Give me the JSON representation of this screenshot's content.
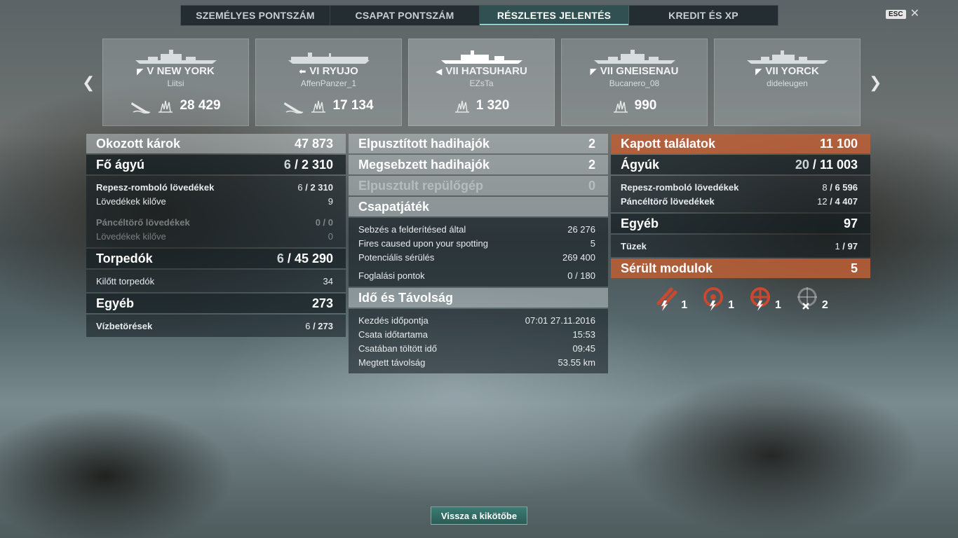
{
  "tabs": [
    "SZEMÉLYES PONTSZÁM",
    "CSAPAT PONTSZÁM",
    "RÉSZLETES JELENTÉS",
    "KREDIT ÉS XP"
  ],
  "esc_label": "ESC",
  "cards": [
    {
      "tier": "V",
      "name": "NEW YORK",
      "player": "Liitsi",
      "damage": "28 429",
      "class_icon": "battleship-icon",
      "has_kill": true
    },
    {
      "tier": "VI",
      "name": "RYUJO",
      "player": "AffenPanzer_1",
      "damage": "17 134",
      "class_icon": "carrier-icon",
      "has_kill": true
    },
    {
      "tier": "VII",
      "name": "HATSUHARU",
      "player": "EZsTa",
      "damage": "1 320",
      "class_icon": "destroyer-icon",
      "has_kill": false
    },
    {
      "tier": "VII",
      "name": "GNEISENAU",
      "player": "Bucanero_08",
      "damage": "990",
      "class_icon": "battleship-icon",
      "has_kill": false
    },
    {
      "tier": "VII",
      "name": "YORCK",
      "player": "dideleugen",
      "damage": "",
      "class_icon": "cruiser-icon",
      "has_kill": false
    }
  ],
  "left": {
    "damage": {
      "label": "Okozott károk",
      "value": "47 873"
    },
    "main_guns": {
      "label": "Fő ágyú",
      "hits": "6",
      "value": "2 310"
    },
    "he": {
      "label": "Repesz-romboló lövedékek",
      "hits": "6",
      "value": "2 310"
    },
    "he_fired": {
      "label": "Lövedékek kilőve",
      "value": "9"
    },
    "ap": {
      "label": "Páncéltörő lövedékek",
      "value": "0 / 0"
    },
    "ap_fired": {
      "label": "Lövedékek kilőve",
      "value": "0"
    },
    "torpedoes": {
      "label": "Torpedók",
      "hits": "6",
      "value": "45 290"
    },
    "torp_fired": {
      "label": "Kilőtt torpedók",
      "value": "34"
    },
    "other": {
      "label": "Egyéb",
      "value": "273"
    },
    "flooding": {
      "label": "Vízbetörések",
      "hits": "6",
      "value": "273"
    }
  },
  "middle": {
    "destroyed": {
      "label": "Elpusztított hadihajók",
      "value": "2"
    },
    "damaged": {
      "label": "Megsebzett hadihajók",
      "value": "2"
    },
    "planes": {
      "label": "Elpusztult repülőgép",
      "value": "0"
    },
    "team_head": "Csapatjáték",
    "spotting_dmg": {
      "label": "Sebzés a felderítésed által",
      "value": "26 276"
    },
    "fires_spot": {
      "label": "Fires caused upon your spotting",
      "value": "5"
    },
    "potential": {
      "label": "Potenciális sérülés",
      "value": "269 400"
    },
    "capture": {
      "label": "Foglalási pontok",
      "value": "0 / 180"
    },
    "time_head": "Idő és Távolság",
    "start": {
      "label": "Kezdés időpontja",
      "value": "07:01  27.11.2016"
    },
    "duration": {
      "label": "Csata időtartama",
      "value": "15:53"
    },
    "alive": {
      "label": "Csatában töltött idő",
      "value": "09:45"
    },
    "distance": {
      "label": "Megtett távolság",
      "value": "53.55 km"
    }
  },
  "right": {
    "received": {
      "label": "Kapott találatok",
      "value": "11 100"
    },
    "guns": {
      "label": "Ágyúk",
      "hits": "20",
      "value": "11 003"
    },
    "he": {
      "label": "Repesz-romboló lövedékek",
      "hits": "8",
      "value": "6 596"
    },
    "ap": {
      "label": "Páncéltörő lövedékek",
      "hits": "12",
      "value": "4 407"
    },
    "other": {
      "label": "Egyéb",
      "value": "97"
    },
    "fires": {
      "label": "Tüzek",
      "hits": "1",
      "value": "97"
    },
    "modules": {
      "label": "Sérült modulok",
      "value": "5"
    },
    "module_items": [
      {
        "icon": "torpedo-tubes-icon",
        "count": "1"
      },
      {
        "icon": "engine-icon",
        "count": "1"
      },
      {
        "icon": "steering-icon",
        "count": "1"
      },
      {
        "icon": "gun-destroyed-icon",
        "count": "2"
      }
    ]
  },
  "back_button": "Vissza a kikötőbe",
  "colors": {
    "accent": "#3d7c74",
    "received_header": "#b95f37"
  }
}
